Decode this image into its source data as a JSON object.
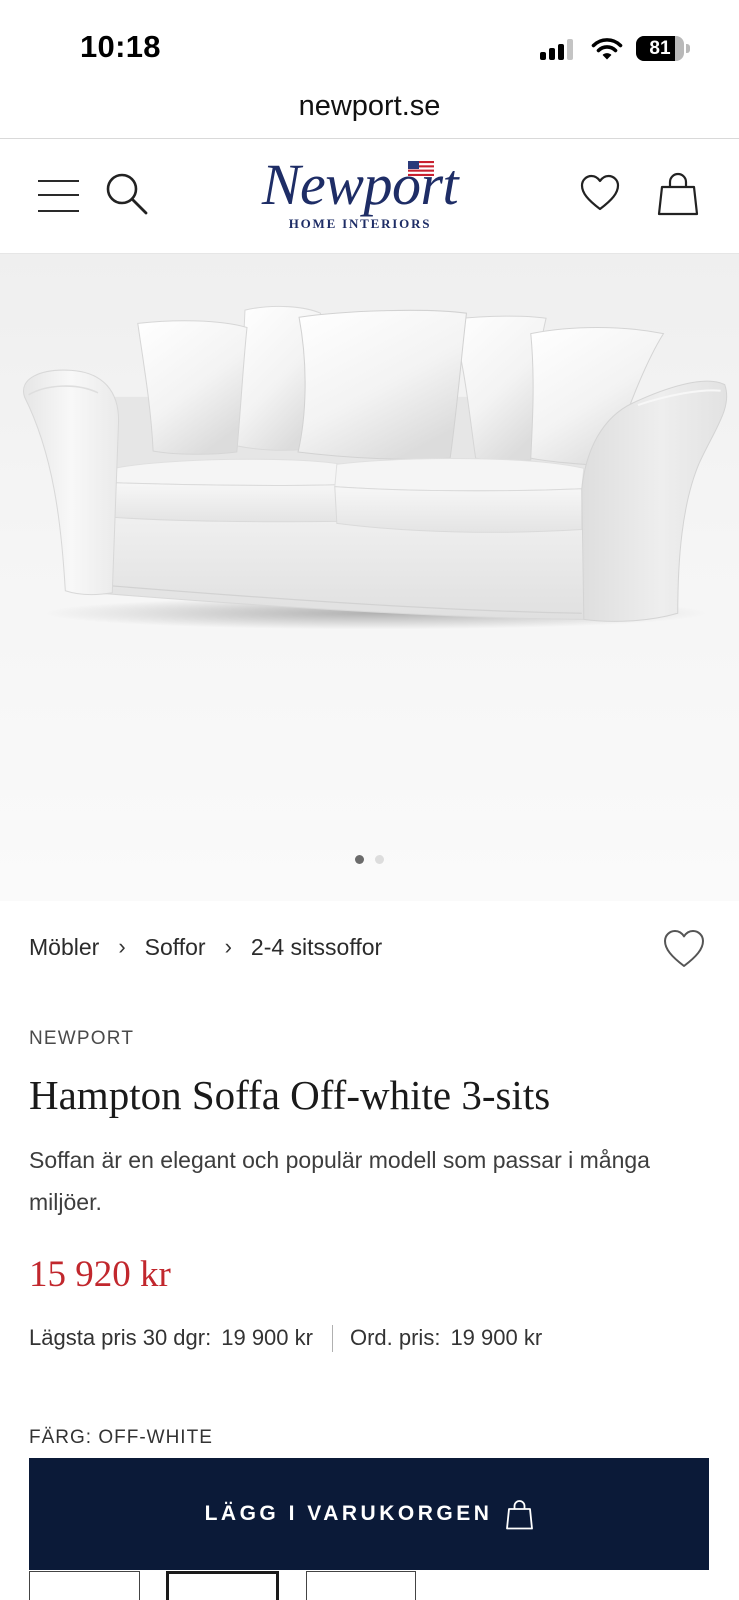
{
  "status_bar": {
    "time": "10:18",
    "battery_level": "81"
  },
  "browser": {
    "url": "newport.se"
  },
  "header": {
    "logo_text": "Newport",
    "logo_tagline": "HOME INTERIORS",
    "icons": [
      "menu-icon",
      "search-icon",
      "heart-icon",
      "shopping-bag-icon"
    ]
  },
  "gallery": {
    "slides": [
      {
        "active": true
      },
      {
        "active": false
      }
    ]
  },
  "breadcrumb": {
    "separator": "›",
    "items": [
      "Möbler",
      "Soffor",
      "2-4 sitssoffor"
    ]
  },
  "product": {
    "brand": "NEWPORT",
    "title": "Hampton Soffa Off-white 3-sits",
    "description": "Soffan är en elegant och populär modell som passar i många miljöer.",
    "price": "15 920 kr",
    "lowest_price_label": "Lägsta pris 30 dgr:",
    "lowest_price": "19 900 kr",
    "ordinary_price_label": "Ord. pris:",
    "ordinary_price": "19 900 kr",
    "color_label": "FÄRG: OFF-WHITE"
  },
  "add_to_cart": {
    "label": "LÄGG I VARUKORGEN",
    "icon": "shopping-bag-icon"
  },
  "variant_options": [
    {
      "selected": false
    },
    {
      "selected": true
    },
    {
      "selected": false
    }
  ],
  "theme": {
    "navy": "#0b1a38",
    "price_red": "#c1272d",
    "logo_navy": "#1e2d66"
  }
}
